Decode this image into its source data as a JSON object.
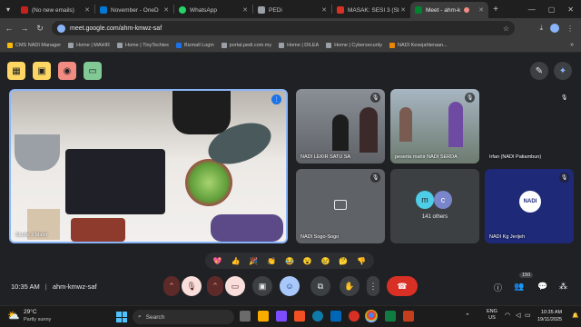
{
  "tabs": [
    {
      "label": "(No new emails)",
      "color": "#c5221f"
    },
    {
      "label": "November - OneD",
      "color": "#0078d4"
    },
    {
      "label": "WhatsApp",
      "color": "#25d366"
    },
    {
      "label": "PEDi",
      "color": "#9aa0a6"
    },
    {
      "label": "MASAK: SESI 3 (SI",
      "color": "#d93025"
    },
    {
      "label": "Meet - ahm-k",
      "color": "#00832d"
    }
  ],
  "address": {
    "url": "meet.google.com/ahm-kmwz-saf"
  },
  "bookmarks": [
    "CMS NADI Manager",
    "Home | MAHIR",
    "Home | TinyTechies",
    "Bizmall Login",
    "portal.pedi.com.my",
    "Home | DILEA",
    "Home | Cybersecurity",
    "NADI Kesejahteraan..."
  ],
  "meeting": {
    "time": "10:35 AM",
    "code": "ahm-kmwz-saf",
    "participant_count": "150"
  },
  "tiles": {
    "main": "Studio 2 Mahir",
    "t1": "NADI LEKIR SATU SA",
    "t2": "peserta mahir NADI SERDA",
    "t3": "Irfan (NADI Patiambun)",
    "t4": "NADI Sogo-Sogo",
    "t5": "141 others",
    "t6": "NADI Kg Jerijeh",
    "t6_logo": "NADI",
    "avatars": [
      "m",
      "c"
    ]
  },
  "reactions": [
    "💖",
    "👍",
    "🎉",
    "👏",
    "😂",
    "😮",
    "😢",
    "🤔",
    "👎"
  ],
  "taskbar": {
    "weather_temp": "29°C",
    "weather_desc": "Partly sunny",
    "search": "Search",
    "lang1": "ENG",
    "lang2": "US",
    "clock_time": "10:35 AM",
    "clock_date": "19/11/2025"
  }
}
